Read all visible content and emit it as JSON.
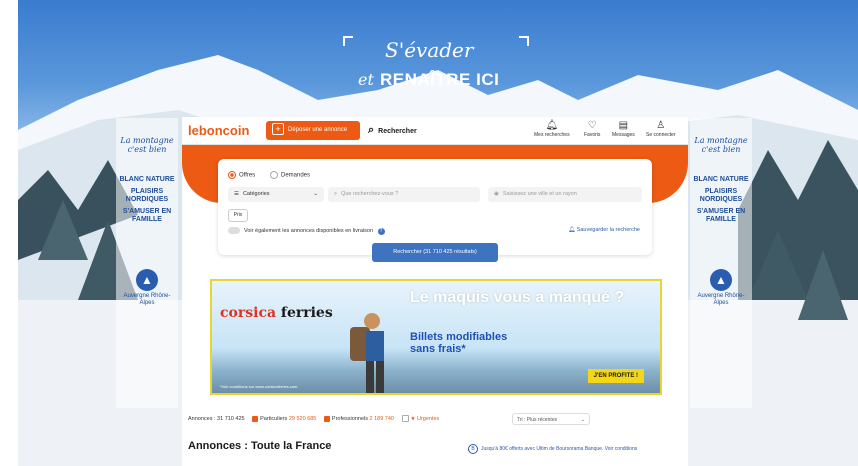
{
  "hero": {
    "line1": "S'évader",
    "line2_script": "et",
    "line2_bold": "RENAÎTRE ICI"
  },
  "side_panel": {
    "script_text": "La montagne c'est bien",
    "lines": [
      "BLANC NATURE",
      "PLAISIRS NORDIQUES",
      "S'AMUSER EN FAMILLE"
    ],
    "region": "Auvergne Rhône-Alpes"
  },
  "header": {
    "logo": "leboncoin",
    "deposit_label": "Déposer une annonce",
    "search_tab": "Rechercher",
    "nav": [
      {
        "label": "Mes recherches",
        "icon": "bell-icon"
      },
      {
        "label": "Favoris",
        "icon": "heart-icon"
      },
      {
        "label": "Messages",
        "icon": "message-icon"
      },
      {
        "label": "Se connecter",
        "icon": "user-icon"
      }
    ]
  },
  "search": {
    "offres": "Offres",
    "demandes": "Demandes",
    "category": "Catégories",
    "query_placeholder": "Que recherchez-vous ?",
    "location_placeholder": "Saisissez une ville et un rayon",
    "prix": "Prix",
    "delivery_toggle": "Voir également les annonces disponibles en livraison",
    "save_search": "Sauvegarder la recherche",
    "button": "Rechercher (31 710 425 résultats)"
  },
  "ad": {
    "brand_a": "corsica",
    "brand_b": "ferries",
    "headline": "Le maquis vous a manqué ?",
    "sub": "Billets modifiables sans frais*",
    "cta": "J'EN PROFITE !",
    "fineprint": "*Voir conditions sur www.corsicaferries.com"
  },
  "results": {
    "total_label": "Annonces : 31 710 425",
    "particuliers_label": "Particuliers",
    "particuliers_count": "29 520 685",
    "pros_label": "Professionnels",
    "pros_count": "2 189 740",
    "urgentes_label": "Urgentes",
    "sort": "Tri : Plus récentes",
    "title": "Annonces : Toute la France",
    "promo": "Jusqu'à 80€ offerts avec Ultim de Boursorama Banque. Voir conditions"
  },
  "colors": {
    "brand_orange": "#ec5a13",
    "primary_blue": "#3e73c0"
  }
}
